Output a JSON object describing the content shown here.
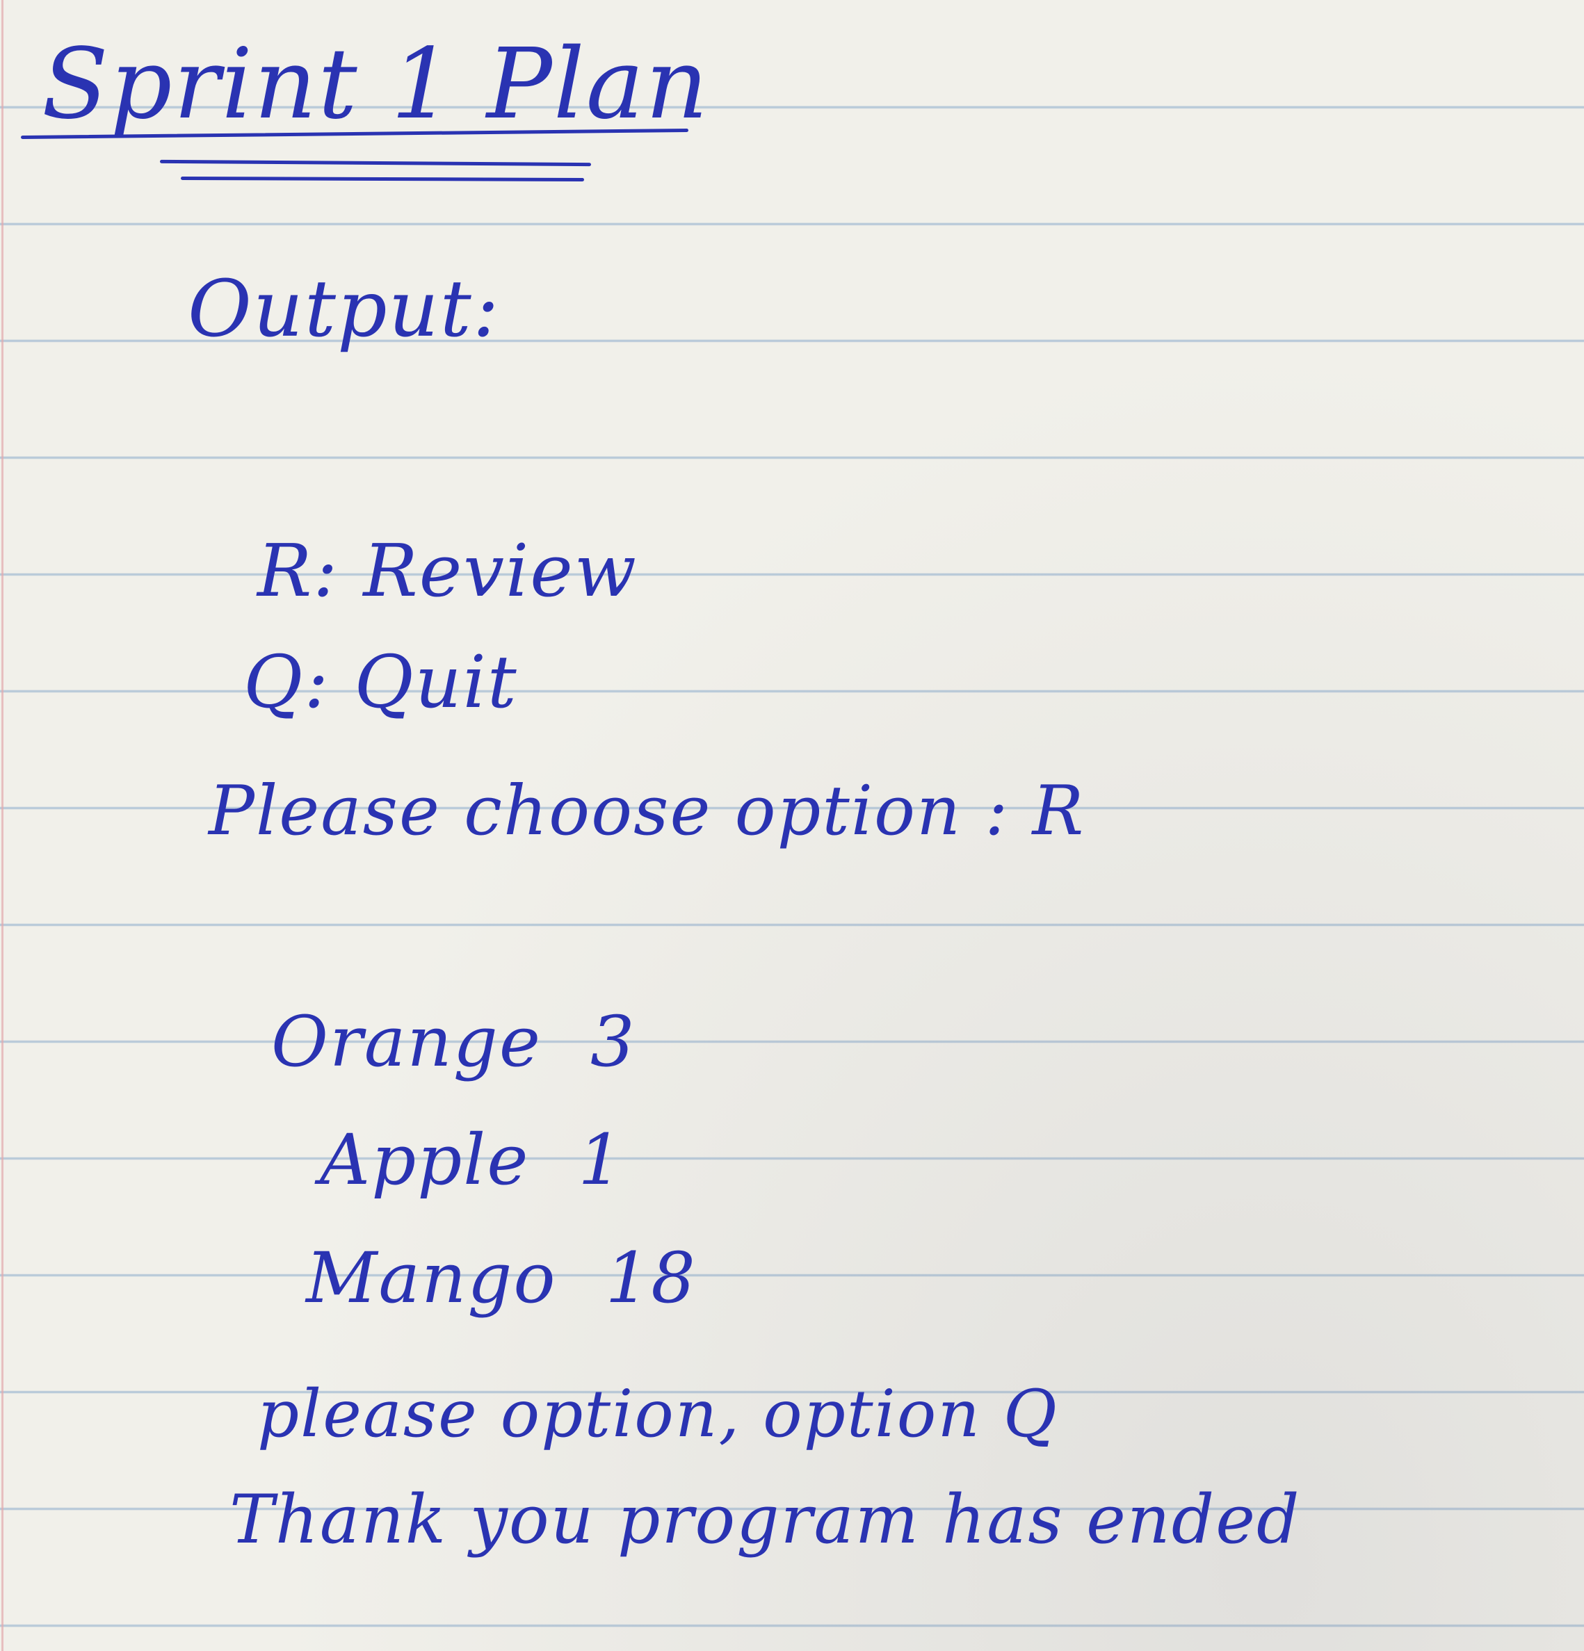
{
  "note": {
    "title": "Sprint 1 Plan",
    "output_label": "Output:",
    "menu": [
      {
        "text": "R: Review"
      },
      {
        "text": "Q: Quit"
      }
    ],
    "prompt_1": "Please choose option : R",
    "inventory": [
      {
        "name": "Orange",
        "qty": "3"
      },
      {
        "name": "Apple",
        "qty": "1"
      },
      {
        "name": "Mango",
        "qty": "18"
      }
    ],
    "prompt_2": "please option, option Q",
    "closing": "Thank you program has ended"
  },
  "colors": {
    "ink": "#2a33b2",
    "paper": "#f1f0ea",
    "rule_line": "#b9cad9",
    "margin_line": "#e2a9ad"
  }
}
